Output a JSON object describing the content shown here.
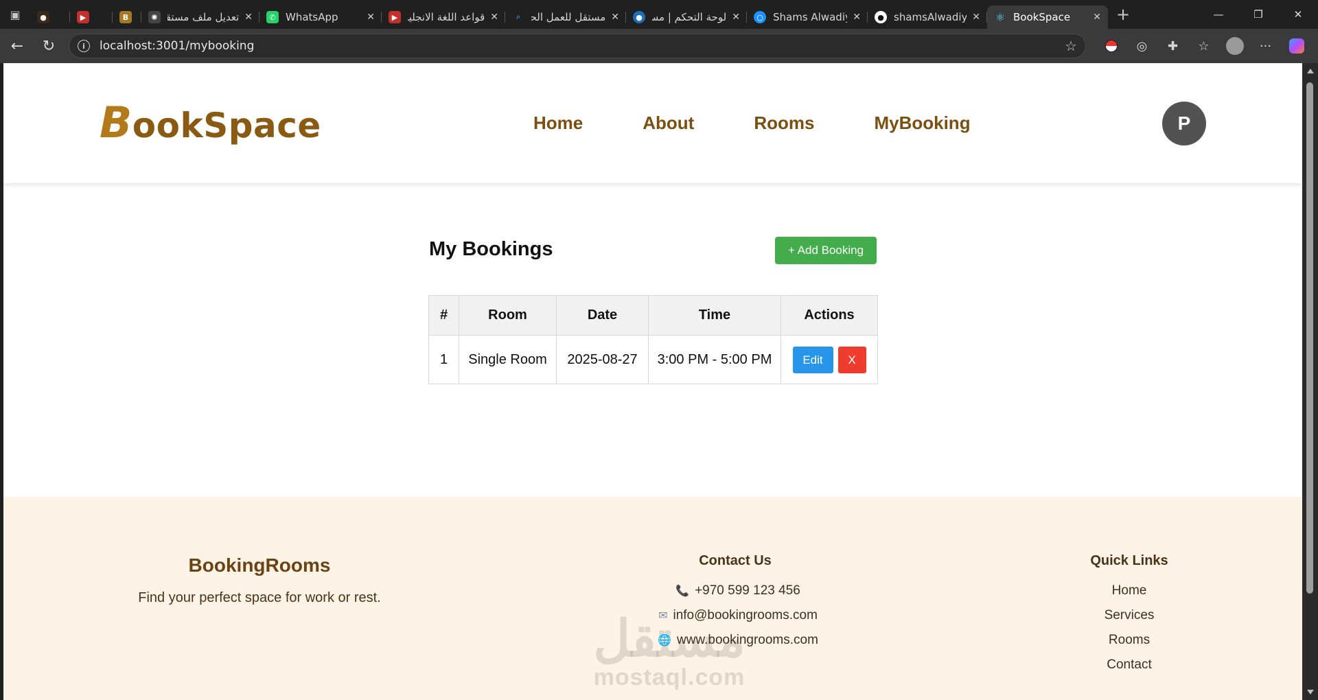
{
  "browser": {
    "tabs": [
      {
        "title": "",
        "favicon_color": "#3b2a18",
        "active": false
      },
      {
        "title": "",
        "favicon_color": "#c4302b",
        "active": false
      },
      {
        "title": "",
        "favicon_color": "#a57a22",
        "active": false
      },
      {
        "title": "تعديل ملف مستقل",
        "favicon_color": "#555555",
        "active": false
      },
      {
        "title": "WhatsApp",
        "favicon_color": "#25d366",
        "active": false
      },
      {
        "title": "قواعد اللغة الانجليزية",
        "favicon_color": "#c4302b",
        "active": false
      },
      {
        "title": "مستقل للعمل الحر",
        "favicon_color": "#2d7ad6",
        "active": false
      },
      {
        "title": "لوحة التحكم | مستقل",
        "favicon_color": "#1b6fb6",
        "active": false
      },
      {
        "title": "Shams Alwadiya",
        "favicon_color": "#1e90ff",
        "active": false
      },
      {
        "title": "shamsAlwadiya",
        "favicon_color": "#ffffff",
        "active": false
      },
      {
        "title": "BookSpace",
        "favicon_color": "#61dafb",
        "active": true
      }
    ],
    "url": "localhost:3001/mybooking"
  },
  "header": {
    "logo_initial": "B",
    "logo_rest": "ookSpace",
    "nav": [
      "Home",
      "About",
      "Rooms",
      "MyBooking"
    ],
    "avatar_letter": "P"
  },
  "bookings": {
    "title": "My Bookings",
    "add_label": "+ Add Booking",
    "columns": [
      "#",
      "Room",
      "Date",
      "Time",
      "Actions"
    ],
    "rows": [
      {
        "num": "1",
        "room": "Single Room",
        "date": "2025-08-27",
        "time": "3:00 PM - 5:00 PM",
        "edit": "Edit",
        "delete": "X"
      }
    ]
  },
  "footer": {
    "brand": "BookingRooms",
    "tagline": "Find your perfect space for work or rest.",
    "contact_title": "Contact Us",
    "phone": "+970 599 123 456",
    "email": "info@bookingrooms.com",
    "website": "www.bookingrooms.com",
    "links_title": "Quick Links",
    "links": [
      "Home",
      "Services",
      "Rooms",
      "Contact"
    ]
  },
  "watermark": {
    "arabic": "مستقل",
    "latin": "mostaql.com"
  },
  "colors": {
    "brand": "#8a5a13",
    "add_button": "#43ad4c",
    "edit_button": "#2796ea",
    "delete_button": "#ee3c2f",
    "footer_bg": "#fdf3e6"
  }
}
